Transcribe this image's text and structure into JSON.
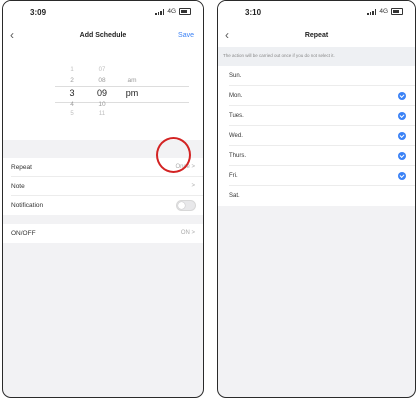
{
  "left_screen": {
    "status": {
      "time": "3:09",
      "network": "4G"
    },
    "nav": {
      "back_icon": "chevron-left-icon",
      "title": "Add Schedule",
      "save_label": "Save"
    },
    "time_picker": {
      "hours": [
        "",
        "1",
        "2",
        "3",
        "4",
        "5",
        ""
      ],
      "minutes": [
        "",
        "07",
        "08",
        "09",
        "10",
        "11",
        ""
      ],
      "ampm": [
        "",
        "",
        "am",
        "pm",
        "",
        "",
        ""
      ],
      "selected": {
        "hour": "3",
        "minute": "09",
        "ampm": "pm"
      }
    },
    "settings": [
      {
        "label": "Repeat",
        "value": "Once >"
      },
      {
        "label": "Note",
        "value": ">"
      },
      {
        "label": "Notification",
        "toggle": false
      }
    ],
    "onoff": {
      "label": "ON/OFF",
      "value": "ON >"
    }
  },
  "right_screen": {
    "status": {
      "time": "3:10",
      "network": "4G"
    },
    "nav": {
      "back_icon": "chevron-left-icon",
      "title": "Repeat"
    },
    "description": "The action will be carried out once if you do not select it.",
    "days": [
      {
        "label": "Sun.",
        "checked": false
      },
      {
        "label": "Mon.",
        "checked": true
      },
      {
        "label": "Tues.",
        "checked": true
      },
      {
        "label": "Wed.",
        "checked": true
      },
      {
        "label": "Thurs.",
        "checked": true
      },
      {
        "label": "Fri.",
        "checked": true
      },
      {
        "label": "Sat.",
        "checked": false
      }
    ]
  },
  "colors": {
    "accent": "#3b82f6",
    "annotation_ring": "#d32323"
  }
}
